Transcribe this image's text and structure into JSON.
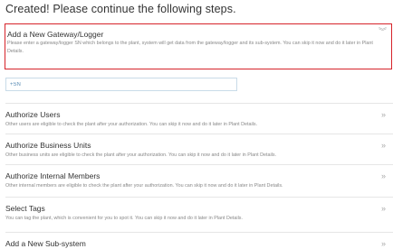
{
  "header": {
    "title": "Created! Please continue the following steps."
  },
  "steps": [
    {
      "title": "Add a New Gateway/Logger",
      "description": "Please enter a gateway/logger SN which belongs to the plant, system will get data from the gateway/logger and its sub-system. You can skip it now and do it later in Plant Details.",
      "icon": "chevron-double-down-icon"
    },
    {
      "title": "Authorize Users",
      "description": "Other users are eligible to check the plant after your authorization. You can skip it now and do it later in Plant Details.",
      "icon": "chevron-double-right-icon"
    },
    {
      "title": "Authorize Business Units",
      "description": "Other business units are eligible to check the plant after your authorization. You can skip it now and do it later in Plant Details.",
      "icon": "chevron-double-right-icon"
    },
    {
      "title": "Authorize Internal Members",
      "description": "Other internal members are eligible to check the plant after your authorization. You can skip it now and do it later in Plant Details.",
      "icon": "chevron-double-right-icon"
    },
    {
      "title": "Select Tags",
      "description": "You can tag the plant, which is convenient for you to spot it. You can skip it now and do it later in Plant Details.",
      "icon": "chevron-double-right-icon"
    },
    {
      "title": "Add a New Sub-system",
      "description": "",
      "icon": "chevron-double-right-icon"
    }
  ],
  "sn_input": {
    "placeholder": "+SN",
    "value": ""
  },
  "colors": {
    "active_border": "#d6232a",
    "input_text": "#5a8db5",
    "muted_text": "#888888"
  }
}
